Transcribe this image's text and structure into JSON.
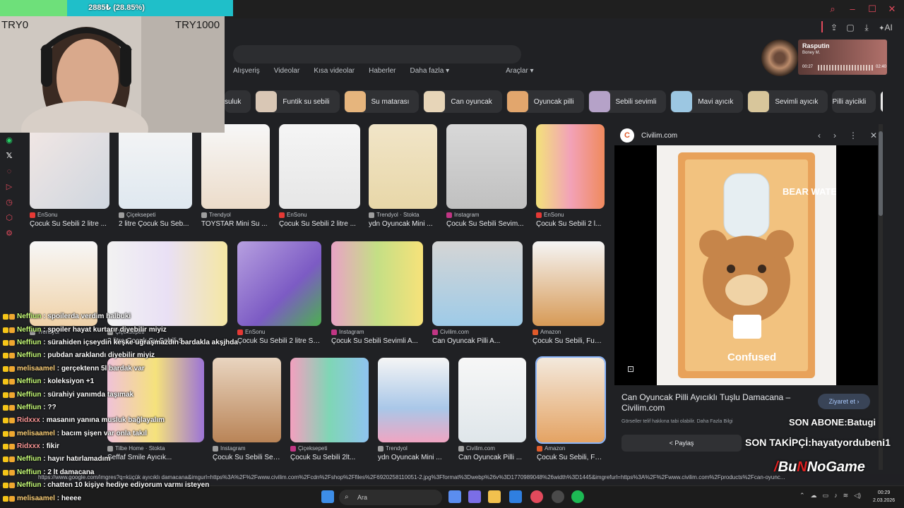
{
  "stream": {
    "goal_text": "2885₺ (28.85%)",
    "goal_progress": 0.2885,
    "goal_min": "TRY0",
    "goal_max": "TRY1000",
    "son_abone": "SON ABONE:Batugi",
    "son_takipci": "SON TAKİPÇİ:hayatyordubeni1",
    "brand_prefix": "Bu",
    "brand_suffix": "NoGame"
  },
  "music": {
    "song": "Rasputin",
    "artist": "Boney M.",
    "elapsed": "00:27",
    "duration": "02:40"
  },
  "google": {
    "tabs": [
      "Alışveriş",
      "Videolar",
      "Kısa videolar",
      "Haberler",
      "Daha fazla ▾"
    ],
    "tools": "Araçlar ▾",
    "chips": [
      "suluk",
      "Funtik su sebili",
      "Su matarası",
      "Can oyuncak",
      "Oyuncak pilli",
      "Sebili sevimli",
      "Mavi ayıcık",
      "Sevimli ayıcık",
      "Pilli ayicikli"
    ],
    "results": [
      {
        "source": "EnSonu",
        "title": "Çocuk Su Sebili 2 litre ..."
      },
      {
        "source": "Çiçeksepeti",
        "title": "2 litre Çocuk Su Seb..."
      },
      {
        "source": "Trendyol",
        "title": "TOYSTAR Mini Su ..."
      },
      {
        "source": "EnSonu",
        "title": "Çocuk Su Sebili 2 litre ..."
      },
      {
        "source": "Trendyol · Stokta",
        "title": "ydn Oyuncak Mini ..."
      },
      {
        "source": "Instagram",
        "title": "Çocuk Su Sebili Sevim..."
      },
      {
        "source": "EnSonu",
        "title": "Çocuk Su Sebili 2 l..."
      },
      {
        "source": "Trendyol",
        "title": ""
      },
      {
        "source": "Çiçeksepeti",
        "title": "2 litre Çocuk Su Sebili S..."
      },
      {
        "source": "EnSonu",
        "title": "Çocuk Su Sebili 2 litre Sev..."
      },
      {
        "source": "Instagram",
        "title": "Çocuk Su Sebili Sevimli A..."
      },
      {
        "source": "Civilim.com",
        "title": "Can Oyuncak Pilli A..."
      },
      {
        "source": "Amazon",
        "title": "Çocuk Su Sebili, Funtik Mini..."
      },
      {
        "source": "Tilbe Home · Stokta",
        "title": "Şeffaf Smile Ayıcık..."
      },
      {
        "source": "Instagram",
        "title": "Çocuk Su Sebili Sevi..."
      },
      {
        "source": "Çiçeksepeti",
        "title": "Çocuk Su Sebili 2lt..."
      },
      {
        "source": "Trendyol",
        "title": "ydn Oyuncak Mini ..."
      },
      {
        "source": "Civilim.com",
        "title": "Can Oyuncak Pilli ..."
      }
    ],
    "panel": {
      "site": "Civilim.com",
      "title": "Can Oyuncak Pilli Ayıcıklı Tuşlu Damacana – Civilim.com",
      "visit": "Ziyaret et",
      "rights": "Görseller telif hakkına tabi olabilir. Daha Fazla Bilgi",
      "share": "Paylaş",
      "box_top": "BEAR WATER",
      "box_bottom": "Confused"
    },
    "status_url": "https://www.google.com/imgres?q=küçük ayıcıklı damacana&imgurl=https%3A%2F%2Fwww.civilim.com%2Fcdn%2Fshop%2Ffiles%2F6920258110051-2.jpg%3Fformat%3Dwebp%26v%3D1770989048%26width%3D1445&imgrefurl=https%3A%2F%2Fwww.civilim.com%2Fproducts%2Fcan-oyunc..."
  },
  "chat": [
    {
      "user": "Neffiun",
      "text": "spoilerda verdim halbuki"
    },
    {
      "user": "Neffiun",
      "text": "spoiler hayat kurtarır diyebilir miyiz"
    },
    {
      "user": "Neffiun",
      "text": "sürahiden içseydin keşke uğraşmazdın bardakla akşjhda"
    },
    {
      "user": "Neffiun",
      "text": "pubdan araklandı diyebilir miyiz"
    },
    {
      "user": "melisaamel",
      "text": "gerçektenn 5l bardak var"
    },
    {
      "user": "Neffiun",
      "text": "koleksiyon +1"
    },
    {
      "user": "Neffiun",
      "text": "sürahiyi yanımda taşımak"
    },
    {
      "user": "Neffiun",
      "text": "??"
    },
    {
      "user": "Ridxxx",
      "text": "masanın yanına musluk bağlayalım"
    },
    {
      "user": "melisaamel",
      "text": "bacım şişen var onla takıl"
    },
    {
      "user": "Ridxxx",
      "text": "fikir"
    },
    {
      "user": "Neffiun",
      "text": "hayır hatırlamadım"
    },
    {
      "user": "Neffiun",
      "text": "2 lt damacana"
    },
    {
      "user": "Neffiun",
      "text": "chatten 10 kişiye hediye ediyorum varmı isteyen"
    },
    {
      "user": "melisaamel",
      "text": "heeee"
    }
  ],
  "taskbar": {
    "search": "Ara",
    "time": "00:29",
    "date": "2.03.2026"
  },
  "toolbar": {
    "ai_label": "AI"
  },
  "colors": {
    "accent_red": "#e24a5c",
    "goal_teal": "#1fbfc9",
    "goal_green": "#6ee07a",
    "link_blue": "#8ab4f8"
  }
}
